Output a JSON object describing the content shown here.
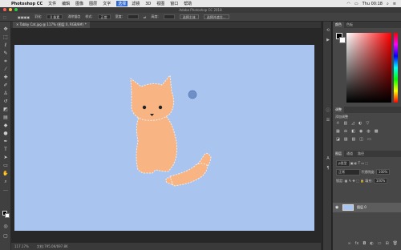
{
  "menubar": {
    "apple": "",
    "app": "Photoshop CC",
    "items": [
      "文件",
      "编辑",
      "图像",
      "图层",
      "文字",
      "选择",
      "滤镜",
      "3D",
      "视图",
      "窗口",
      "帮助"
    ],
    "active_index": 5,
    "clock": "Thu 00:18"
  },
  "window": {
    "title": "Adobe Photoshop CC 2018"
  },
  "options": {
    "feather_label": "羽化:",
    "feather_value": "0 像素",
    "antialias_label": "消除锯齿",
    "style_label": "样式:",
    "style_value": "正常",
    "width_label": "宽度:",
    "height_label": "高度:",
    "select_subject": "选择主体",
    "select_mask": "选择并遮住..."
  },
  "document": {
    "tab_label": "Tabby Cat.jpg @ 117% (图层 0, RGB/8#) *"
  },
  "status": {
    "zoom": "117.17%",
    "doc_info": "文档:795.0K/697.8K"
  },
  "panels": {
    "color_tabs": [
      "颜色",
      "色板"
    ],
    "adjustments": {
      "tab": "调整",
      "title": "添加调整"
    },
    "layers_tabs": [
      "图层",
      "通道",
      "路径"
    ],
    "kind_label": "ρ类型",
    "blend_mode": "正常",
    "opacity_label": "不透明度:",
    "opacity_value": "100%",
    "lock_label": "锁定:",
    "fill_label": "填充:",
    "fill_value": "100%",
    "layer_name": "图层 0"
  },
  "colors": {
    "canvas": "#a9c5ef",
    "cat": "#f9b483",
    "accent": "#2f6bd8"
  },
  "icons": {
    "tools": [
      "move-tool-icon",
      "marquee-tool-icon",
      "lasso-tool-icon",
      "quick-select-tool-icon",
      "crop-tool-icon",
      "eyedropper-tool-icon",
      "healing-brush-icon",
      "brush-tool-icon",
      "clone-stamp-icon",
      "history-brush-icon",
      "eraser-tool-icon",
      "gradient-tool-icon",
      "blur-tool-icon",
      "dodge-tool-icon",
      "pen-tool-icon",
      "type-tool-icon",
      "path-select-icon",
      "rectangle-tool-icon",
      "hand-tool-icon",
      "zoom-tool-icon"
    ]
  }
}
